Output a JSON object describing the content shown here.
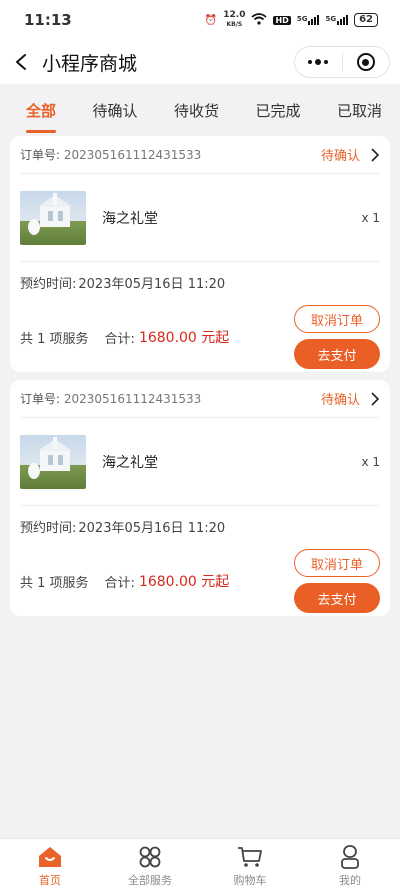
{
  "status_bar": {
    "time": "11:13",
    "net_speed": "12.0",
    "net_unit": "KB/S",
    "hd": "HD",
    "signal1": "5G",
    "signal2": "5G",
    "battery": "62"
  },
  "nav": {
    "title": "小程序商城"
  },
  "tabs": [
    {
      "label": "全部",
      "active": true
    },
    {
      "label": "待确认",
      "active": false
    },
    {
      "label": "待收货",
      "active": false
    },
    {
      "label": "已完成",
      "active": false
    },
    {
      "label": "已取消",
      "active": false
    }
  ],
  "orders": [
    {
      "order_no_label": "订单号:",
      "order_no": "202305161112431533",
      "status": "待确认",
      "item_name": "海之礼堂",
      "qty": "x 1",
      "time_label": "预约时间:",
      "time_value": "2023年05月16日 11:20",
      "count_text": "共 1 项服务",
      "total_label": "合计:",
      "price": "1680.00 元起",
      "cancel_label": "取消订单",
      "pay_label": "去支付"
    },
    {
      "order_no_label": "订单号:",
      "order_no": "202305161112431533",
      "status": "待确认",
      "item_name": "海之礼堂",
      "qty": "x 1",
      "time_label": "预约时间:",
      "time_value": "2023年05月16日 11:20",
      "count_text": "共 1 项服务",
      "total_label": "合计:",
      "price": "1680.00 元起",
      "cancel_label": "取消订单",
      "pay_label": "去支付"
    }
  ],
  "tabbar": [
    {
      "label": "首页",
      "icon": "home-icon",
      "active": true
    },
    {
      "label": "全部服务",
      "icon": "grid-icon",
      "active": false
    },
    {
      "label": "购物车",
      "icon": "cart-icon",
      "active": false
    },
    {
      "label": "我的",
      "icon": "user-icon",
      "active": false
    }
  ],
  "colors": {
    "accent": "#e8622a",
    "price": "#d62a1a",
    "background": "#f2f2f4"
  }
}
